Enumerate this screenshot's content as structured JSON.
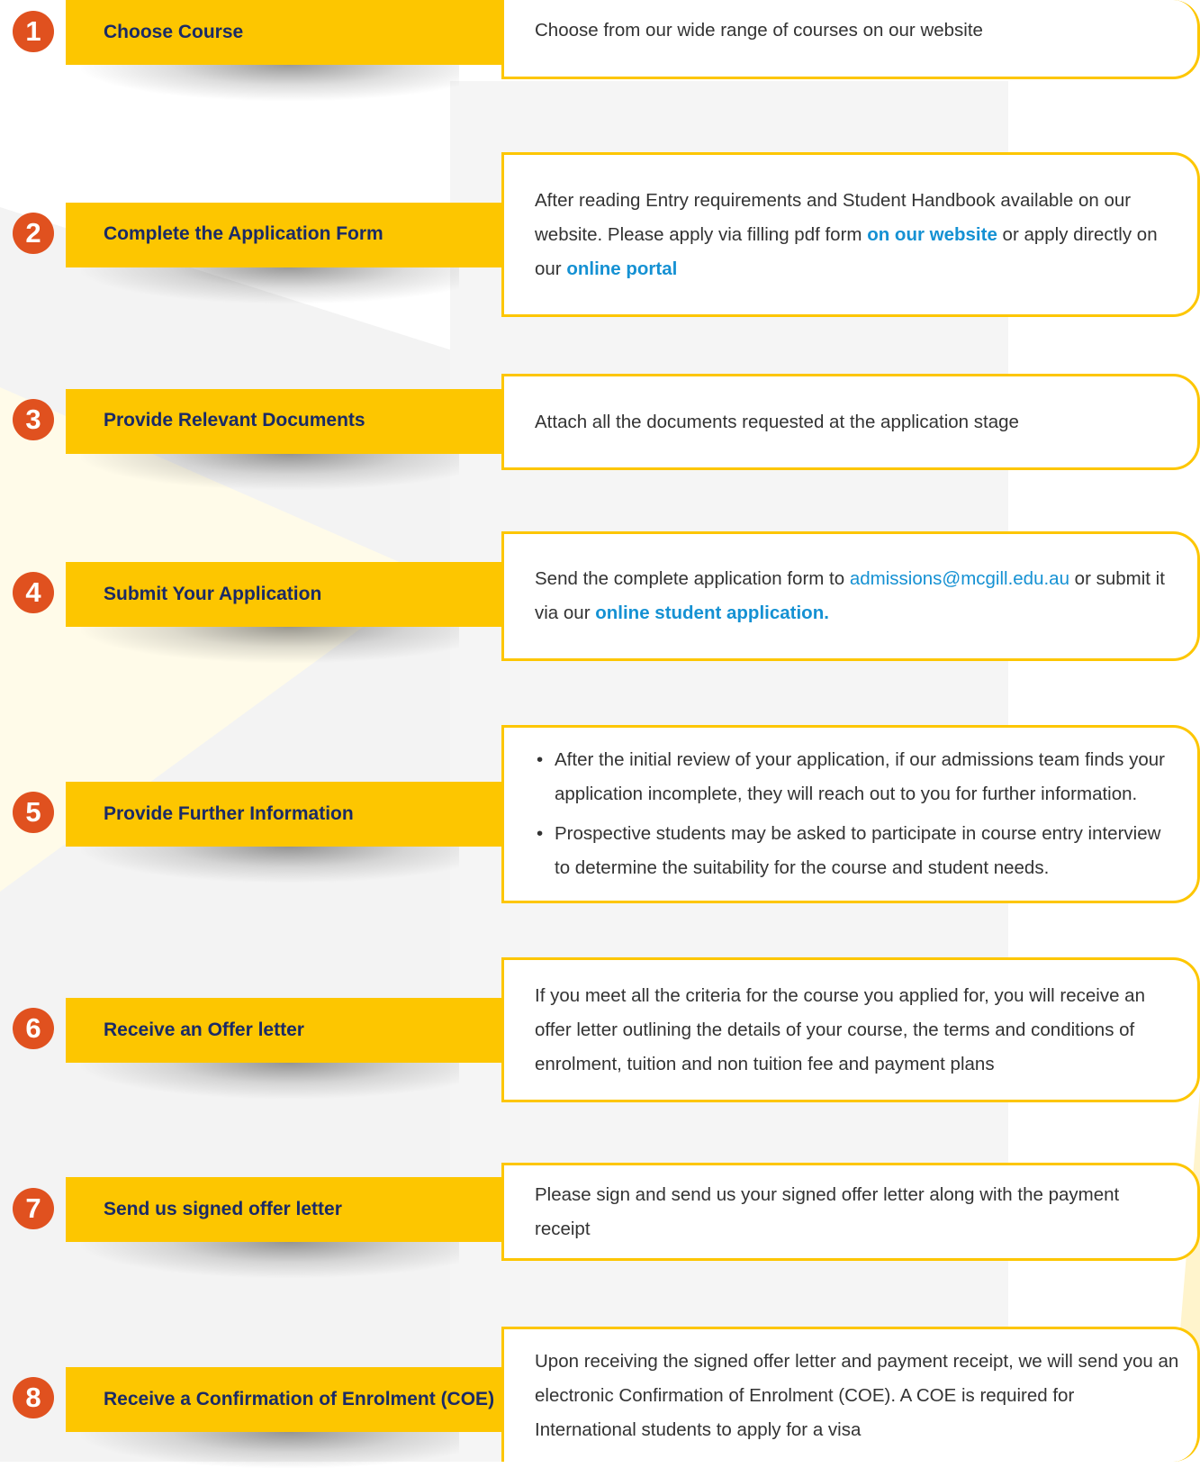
{
  "colors": {
    "accent_yellow": "#fdc600",
    "badge_orange": "#e0511f",
    "label_navy": "#1a2a66",
    "link_blue": "#1591d3",
    "body_text": "#333333"
  },
  "steps": [
    {
      "number": "1",
      "title": "Choose Course",
      "desc": "Choose from our wide range of courses on our website"
    },
    {
      "number": "2",
      "title": "Complete the Application Form",
      "desc_a": "After reading Entry requirements and Student Handbook available on our website. Please apply via filling pdf form ",
      "link1": "on our website",
      "desc_b": " or apply directly on our ",
      "link2": "online portal"
    },
    {
      "number": "3",
      "title": "Provide Relevant Documents",
      "desc": "Attach all the documents requested at the application stage"
    },
    {
      "number": "4",
      "title": "Submit Your Application",
      "desc_a": "Send the complete application form to ",
      "email": "admissions@mcgill.edu.au",
      "desc_b": " or submit it via our ",
      "link1": "online student application."
    },
    {
      "number": "5",
      "title": "Provide Further Information",
      "bullets": [
        "After the initial review of your application, if our admissions team finds your application incomplete, they will reach out to you for further information.",
        "Prospective students may be asked to participate in course entry interview to determine the suitability for the course and student needs."
      ]
    },
    {
      "number": "6",
      "title": "Receive an Offer letter",
      "desc": "If you meet all the criteria for the course you applied for, you will receive an offer letter outlining the details of your course, the terms and conditions of enrolment, tuition and non tuition fee and payment plans"
    },
    {
      "number": "7",
      "title": "Send us signed offer letter",
      "desc": "Please sign and send us your signed offer letter along with the payment receipt"
    },
    {
      "number": "8",
      "title": "Receive a Confirmation of Enrolment (COE)",
      "desc": "Upon receiving the signed offer letter and payment receipt, we will send you an electronic Confirmation of Enrolment (COE). A COE is required for International students to apply for a visa"
    }
  ]
}
